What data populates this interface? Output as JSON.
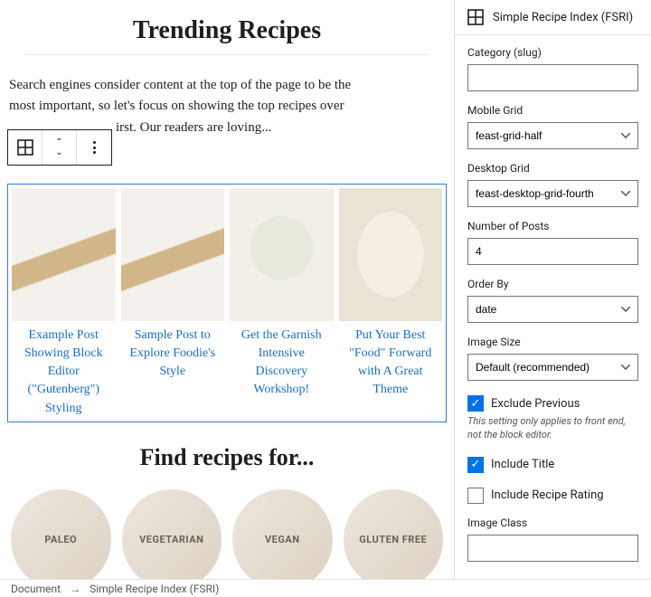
{
  "editor": {
    "heading_trending": "Trending Recipes",
    "intro_line1": "Search engines consider content at the top of the page to be the",
    "intro_line2": "most important, so let's focus on showing the top recipes over",
    "intro_line3": "irst. Our readers are loving...",
    "heading_find": "Find recipes for...",
    "recipes": [
      {
        "title": "Example Post Showing Block Editor (\"Gutenberg\") Styling"
      },
      {
        "title": "Sample Post to Explore Foodie's Style"
      },
      {
        "title": "Get the Garnish Intensive Discovery Workshop!"
      },
      {
        "title": "Put Your Best \"Food\" Forward with A Great Theme"
      }
    ],
    "categories": [
      "PALEO",
      "VEGETARIAN",
      "VEGAN",
      "GLUTEN FREE"
    ]
  },
  "sidebar": {
    "block_name": "Simple Recipe Index (FSRI)",
    "labels": {
      "category": "Category (slug)",
      "mobile": "Mobile Grid",
      "desktop": "Desktop Grid",
      "numposts": "Number of Posts",
      "orderby": "Order By",
      "imagesize": "Image Size",
      "imageclass": "Image Class"
    },
    "values": {
      "category": "",
      "mobile": "feast-grid-half",
      "desktop": "feast-desktop-grid-fourth",
      "numposts": "4",
      "orderby": "date",
      "imagesize": "Default (recommended)"
    },
    "checks": {
      "exclude_prev": "Exclude Previous",
      "exclude_help": "This setting only applies to front end, not the block editor.",
      "include_title": "Include Title",
      "include_rating": "Include Recipe Rating"
    }
  },
  "breadcrumb": {
    "root": "Document",
    "current": "Simple Recipe Index (FSRI)"
  }
}
